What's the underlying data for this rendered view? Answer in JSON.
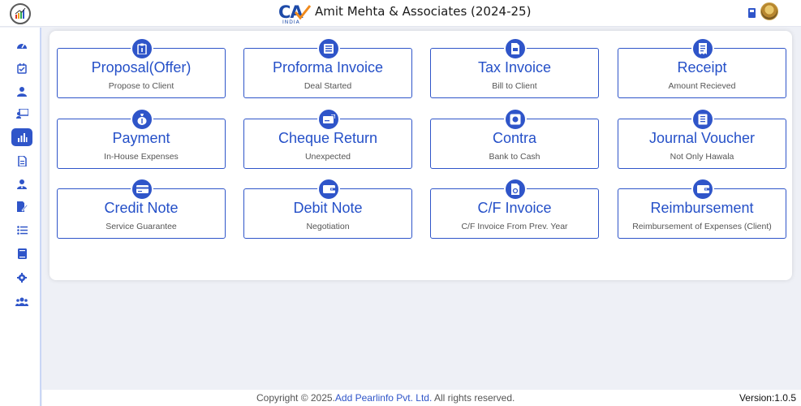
{
  "header": {
    "ca_logo_text": "CA",
    "ca_logo_sub": "INDIA",
    "firm_title": "Amit Mehta & Associates (2024-25)",
    "icons": [
      "app-logo-icon",
      "calculator-icon",
      "user-avatar"
    ]
  },
  "sidebar": {
    "items": [
      {
        "name": "dashboard",
        "icon": "speedometer-icon"
      },
      {
        "name": "calendar",
        "icon": "calendar-check-icon"
      },
      {
        "name": "client",
        "icon": "user-icon"
      },
      {
        "name": "staff",
        "icon": "teacher-icon"
      },
      {
        "name": "accounts",
        "icon": "bar-chart-icon",
        "active": true
      },
      {
        "name": "documents",
        "icon": "document-icon"
      },
      {
        "name": "users",
        "icon": "user-tie-icon"
      },
      {
        "name": "tasks",
        "icon": "edit-file-icon"
      },
      {
        "name": "lists",
        "icon": "list-icon"
      },
      {
        "name": "books",
        "icon": "book-icon"
      },
      {
        "name": "settings",
        "icon": "gear-icon"
      },
      {
        "name": "team",
        "icon": "users-icon"
      }
    ]
  },
  "tiles": [
    {
      "title": "Proposal(Offer)",
      "subtitle": "Propose to Client",
      "icon": "clipboard-icon"
    },
    {
      "title": "Proforma Invoice",
      "subtitle": "Deal Started",
      "icon": "receipt-grid-icon"
    },
    {
      "title": "Tax Invoice",
      "subtitle": "Bill to Client",
      "icon": "invoice-file-icon"
    },
    {
      "title": "Receipt",
      "subtitle": "Amount Recieved",
      "icon": "receipt-icon"
    },
    {
      "title": "Payment",
      "subtitle": "In-House Expenses",
      "icon": "money-bag-icon"
    },
    {
      "title": "Cheque Return",
      "subtitle": "Unexpected",
      "icon": "cheque-icon"
    },
    {
      "title": "Contra",
      "subtitle": "Bank to Cash",
      "icon": "bank-safe-icon"
    },
    {
      "title": "Journal Voucher",
      "subtitle": "Not Only Hawala",
      "icon": "voucher-icon"
    },
    {
      "title": "Credit Note",
      "subtitle": "Service Guarantee",
      "icon": "credit-card-icon"
    },
    {
      "title": "Debit Note",
      "subtitle": "Negotiation",
      "icon": "wallet-icon"
    },
    {
      "title": "C/F Invoice",
      "subtitle": "C/F Invoice From Prev. Year",
      "icon": "invoice-forward-icon"
    },
    {
      "title": "Reimbursement",
      "subtitle": "Reimbursement of Expenses (Client)",
      "icon": "wallet-card-icon"
    }
  ],
  "footer": {
    "copyright_prefix": "Copyright © 2025.",
    "company": "Add Pearlinfo Pvt. Ltd.",
    "copyright_suffix": " All rights reserved.",
    "version": "Version:1.0.5"
  },
  "colors": {
    "accent": "#2f55c9",
    "tile_title": "#2550c8",
    "background": "#eef0f6"
  }
}
